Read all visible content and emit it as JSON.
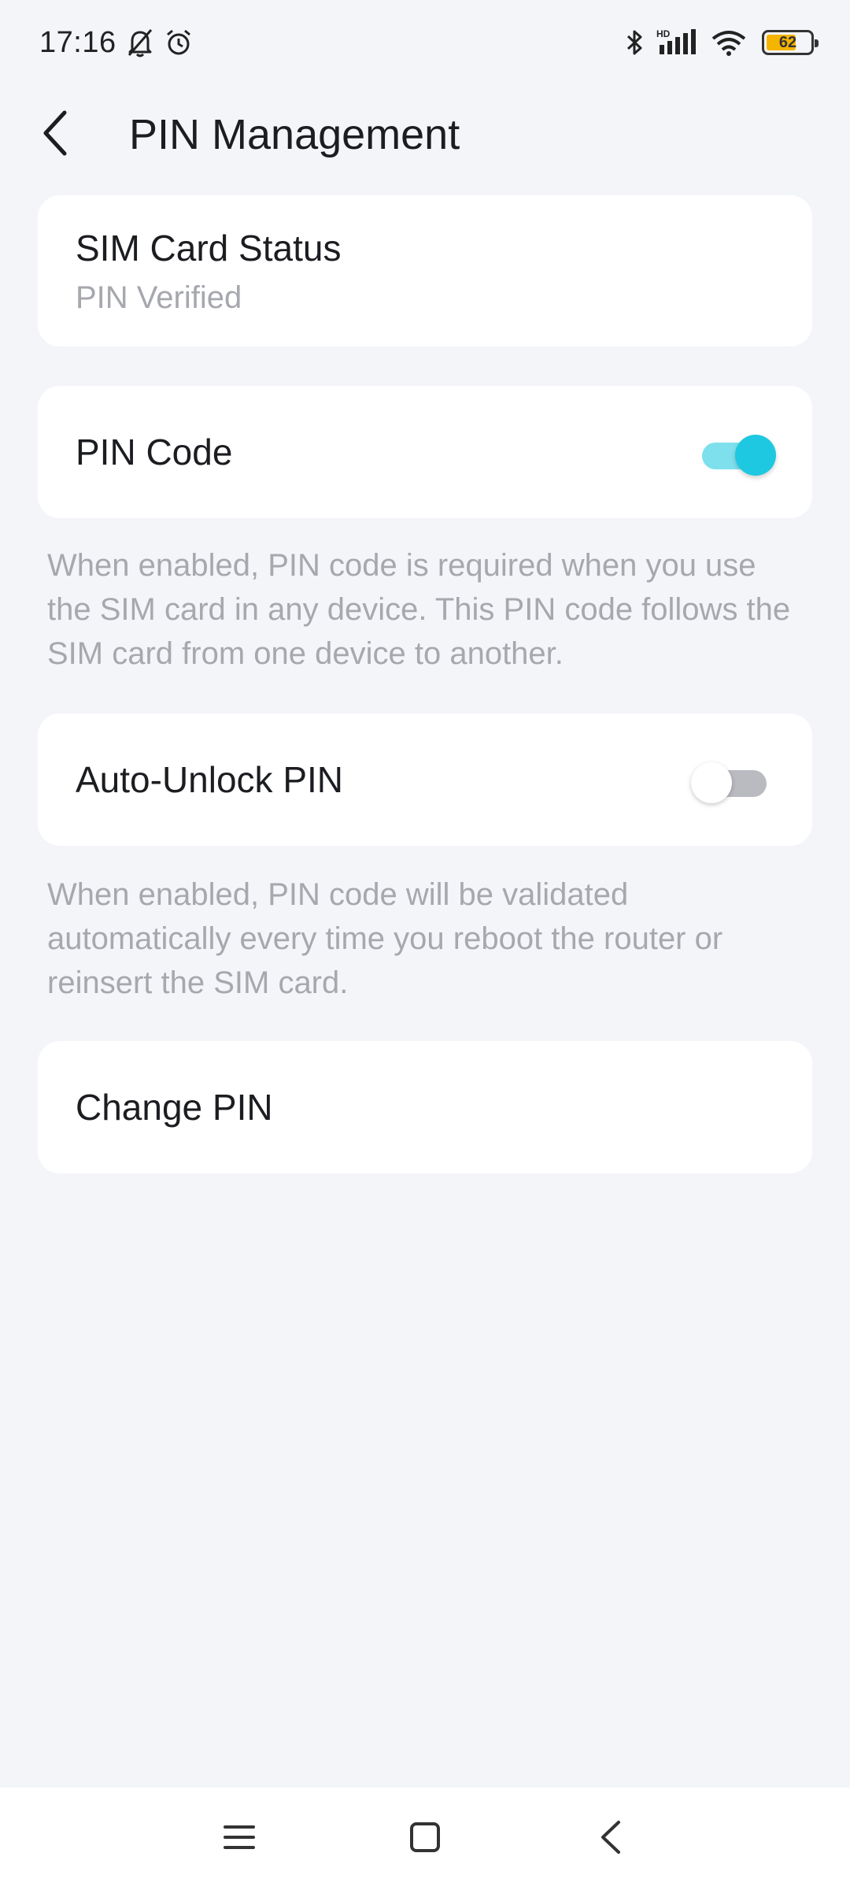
{
  "status_bar": {
    "time": "17:16",
    "icons": [
      "bell-muted-icon",
      "alarm-clock-icon",
      "bluetooth-icon",
      "signal-hd-icon",
      "wifi-icon",
      "battery-icon"
    ],
    "battery_level": "62",
    "hd_label": "HD"
  },
  "header": {
    "title": "PIN Management",
    "back_icon": "chevron-left-icon"
  },
  "sim_status": {
    "title": "SIM Card Status",
    "value": "PIN Verified"
  },
  "pin_code": {
    "label": "PIN Code",
    "enabled": true,
    "description": "When enabled, PIN code is required when you use the SIM card in any device. This PIN code follows the SIM card from one device to another."
  },
  "auto_unlock": {
    "label": "Auto-Unlock PIN",
    "enabled": false,
    "description": "When enabled, PIN code will be validated automatically every time you reboot the router or reinsert the SIM card."
  },
  "change_pin": {
    "label": "Change PIN"
  },
  "colors": {
    "accent": "#1ec8e0",
    "background": "#f4f5f9",
    "secondary_text": "#a6a8ae"
  },
  "nav_bar": {
    "icons": [
      "menu-icon",
      "home-square-icon",
      "back-triangle-icon"
    ]
  }
}
